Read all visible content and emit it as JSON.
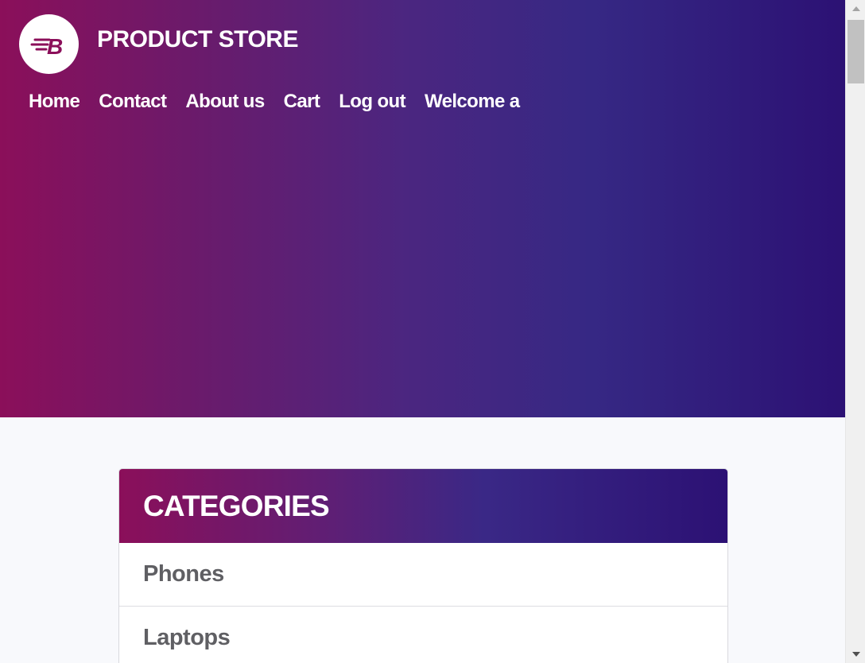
{
  "header": {
    "brand": "PRODUCT STORE",
    "logo_letter": "B",
    "nav": [
      {
        "label": "Home"
      },
      {
        "label": "Contact"
      },
      {
        "label": "About us"
      },
      {
        "label": "Cart"
      },
      {
        "label": "Log out"
      },
      {
        "label": "Welcome a"
      }
    ]
  },
  "categories": {
    "title": "CATEGORIES",
    "items": [
      {
        "label": "Phones"
      },
      {
        "label": "Laptops"
      }
    ]
  },
  "colors": {
    "gradient_start": "#8b0f5a",
    "gradient_end": "#2c1174",
    "logo_mark": "#8b0f5a"
  },
  "icons": {
    "logo": "b-speed-logo-icon",
    "scroll_up": "triangle-up-icon",
    "scroll_down": "triangle-down-icon"
  }
}
